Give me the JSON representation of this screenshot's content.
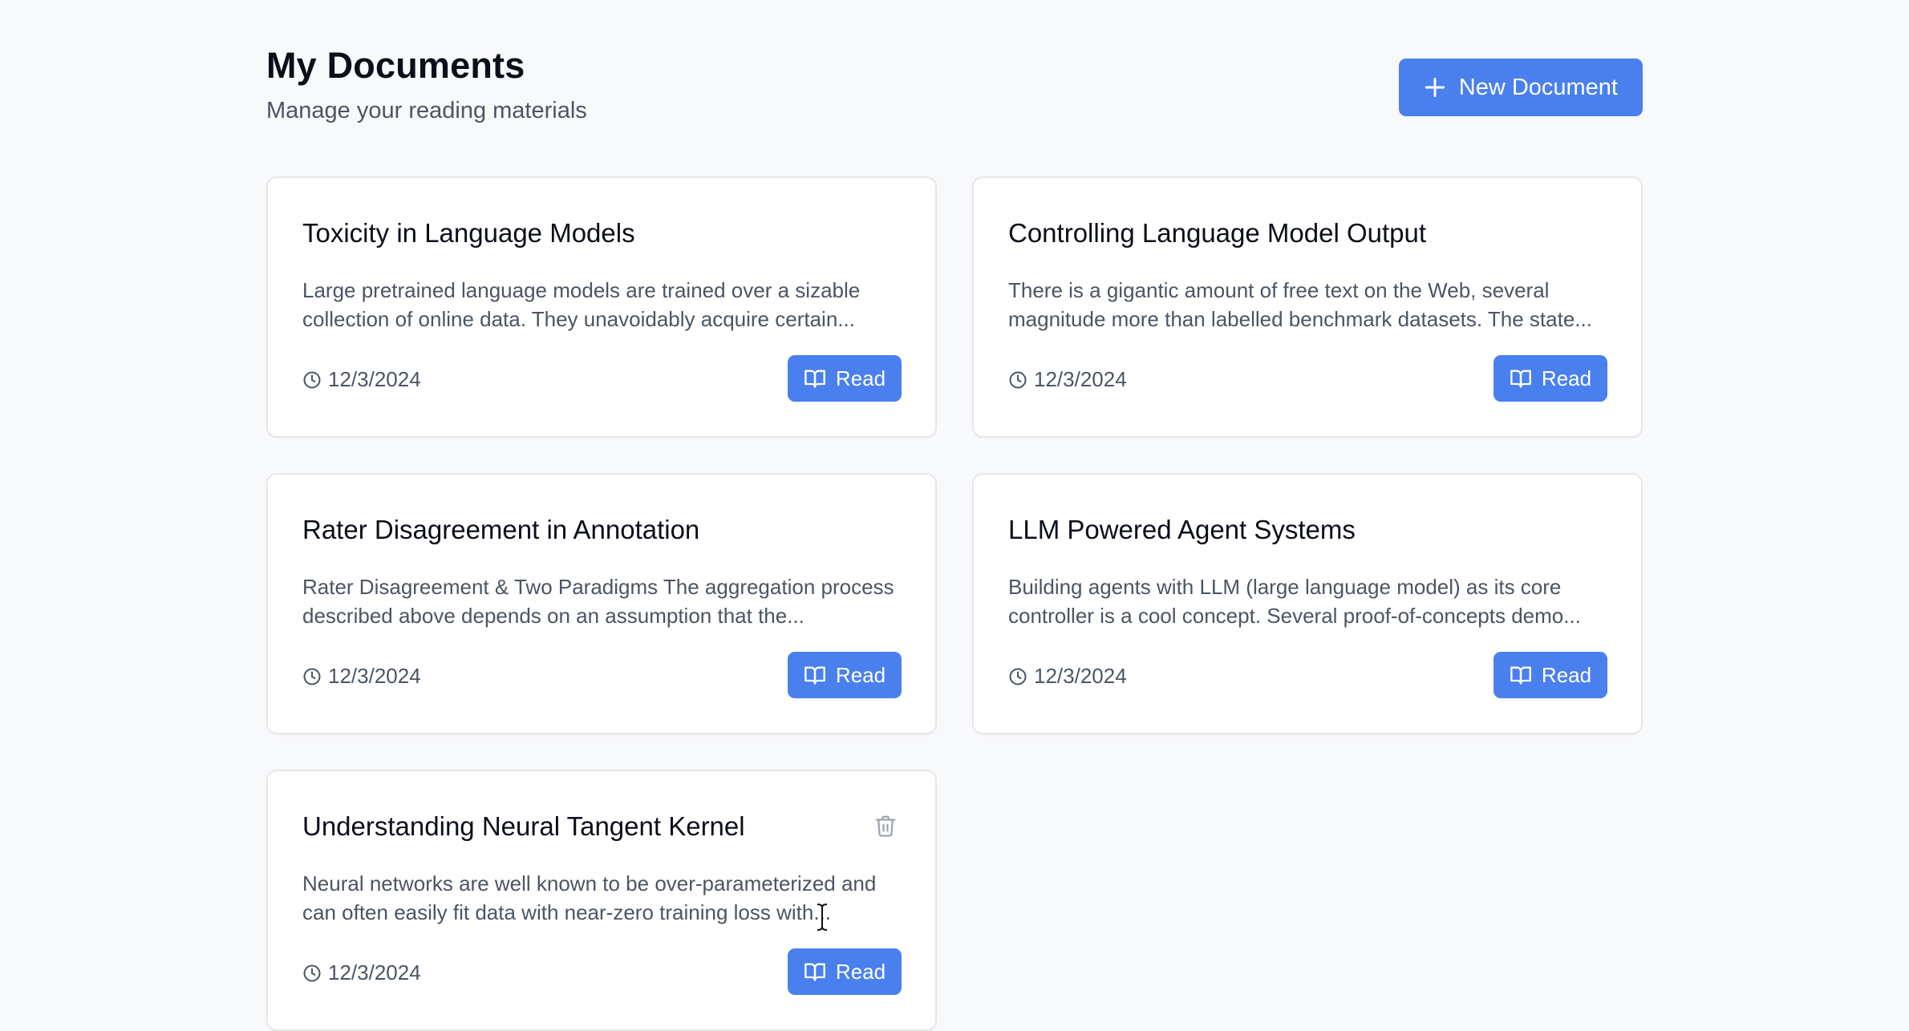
{
  "header": {
    "title": "My Documents",
    "subtitle": "Manage your reading materials",
    "new_button_label": "New Document",
    "new_button_icon": "plus-icon"
  },
  "colors": {
    "accent": "#4a80ee",
    "background": "#f8f9fb",
    "card_border": "#e5e7eb",
    "muted_text": "#4b5563"
  },
  "documents": [
    {
      "title": "Toxicity in Language Models",
      "description": "Large pretrained language models are trained over a sizable collection of online data. They unavoidably acquire certain...",
      "date": "12/3/2024",
      "read_label": "Read",
      "show_delete": false
    },
    {
      "title": "Controlling Language Model Output",
      "description": "There is a gigantic amount of free text on the Web, several magnitude more than labelled benchmark datasets. The state...",
      "date": "12/3/2024",
      "read_label": "Read",
      "show_delete": false
    },
    {
      "title": "Rater Disagreement in Annotation",
      "description": "Rater Disagreement & Two Paradigms The aggregation process described above depends on an assumption that the...",
      "date": "12/3/2024",
      "read_label": "Read",
      "show_delete": false
    },
    {
      "title": "LLM Powered Agent Systems",
      "description": "Building agents with LLM (large language model) as its core controller is a cool concept. Several proof-of-concepts demo...",
      "date": "12/3/2024",
      "read_label": "Read",
      "show_delete": false
    },
    {
      "title": "Understanding Neural Tangent Kernel",
      "description": "Neural networks are well known to be over-parameterized and can often easily fit data with near-zero training loss with...",
      "date": "12/3/2024",
      "read_label": "Read",
      "show_delete": true
    }
  ]
}
